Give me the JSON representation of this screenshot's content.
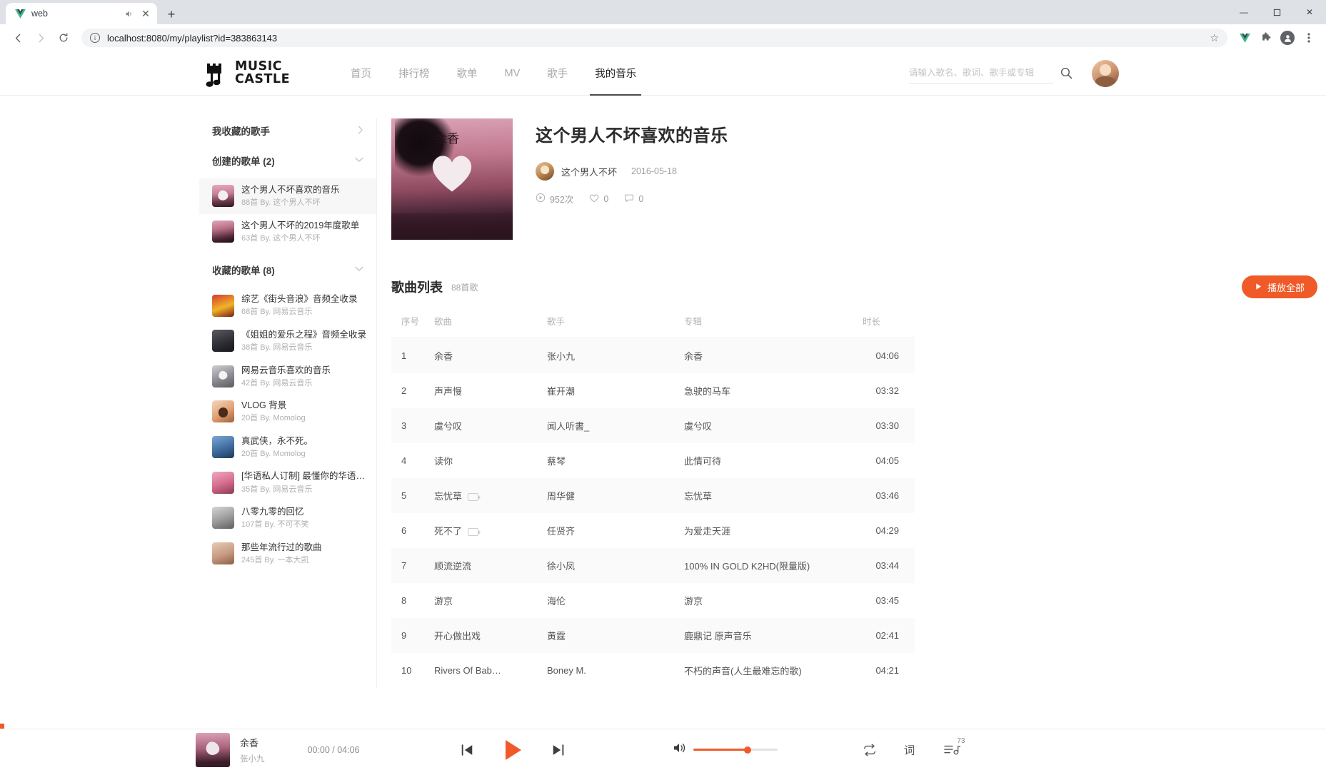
{
  "browser": {
    "tab_title": "web",
    "favicon": "vue-logo-icon",
    "audio_icon": "speaker-icon",
    "close_icon": "close-icon",
    "new_tab_icon": "plus-icon",
    "back_icon": "arrow-left-icon",
    "forward_icon": "arrow-right-icon",
    "reload_icon": "reload-icon",
    "info_icon": "info-icon",
    "url": "localhost:8080/my/playlist?id=383863143",
    "star_icon": "star-icon",
    "extensions_icon": "puzzle-icon",
    "profile_icon": "profile-avatar-icon",
    "menu_icon": "kebab-menu-icon",
    "minimize": "—",
    "maximize": "☐",
    "close": "✕"
  },
  "header": {
    "logo_line1": "MUSIC",
    "logo_line2": "CASTLE",
    "nav": [
      {
        "label": "首页",
        "active": false
      },
      {
        "label": "排行榜",
        "active": false
      },
      {
        "label": "歌单",
        "active": false
      },
      {
        "label": "MV",
        "active": false
      },
      {
        "label": "歌手",
        "active": false
      },
      {
        "label": "我的音乐",
        "active": true
      }
    ],
    "search_placeholder": "请输入歌名、歌词、歌手或专辑",
    "search_value": "",
    "search_icon": "search-icon",
    "avatar": "user-avatar"
  },
  "sidebar": {
    "favorite_artists": {
      "label": "我收藏的歌手",
      "chevron": "›"
    },
    "created_header": {
      "label": "创建的歌单 (2)",
      "chevron": "⌄"
    },
    "created": [
      {
        "title": "这个男人不坏喜欢的音乐",
        "sub": "88首 By. 这个男人不坏",
        "cover": "cov-sunset",
        "selected": true
      },
      {
        "title": "这个男人不坏的2019年度歌单",
        "sub": "63首 By. 这个男人不坏",
        "cover": "cov-sunset2",
        "selected": false
      }
    ],
    "collected_header": {
      "label": "收藏的歌单 (8)",
      "chevron": "⌄"
    },
    "collected": [
      {
        "title": "综艺《街头音浪》音频全收录",
        "sub": "68首 By. 网易云音乐",
        "cover": "cov-var"
      },
      {
        "title": "《姐姐的爱乐之程》音频全收录",
        "sub": "38首 By. 网易云音乐",
        "cover": "cov-grp"
      },
      {
        "title": "网易云音乐喜欢的音乐",
        "sub": "42首 By. 网易云音乐",
        "cover": "cov-bw"
      },
      {
        "title": "VLOG 背景",
        "sub": "20首 By. Momolog",
        "cover": "cov-vlog"
      },
      {
        "title": "真武侠，永不死。",
        "sub": "20首 By. Momolog",
        "cover": "cov-blue"
      },
      {
        "title": "[华语私人订制] 最懂你的华语推…",
        "sub": "35首 By. 网易云音乐",
        "cover": "cov-pink"
      },
      {
        "title": "八零九零的回忆",
        "sub": "107首 By. 不可不笑",
        "cover": "cov-gray"
      },
      {
        "title": "那些年流行过的歌曲",
        "sub": "245首 By. 一本大凯",
        "cover": "cov-warm"
      }
    ]
  },
  "playlist": {
    "name": "这个男人不坏喜欢的音乐",
    "creator": "这个男人不坏",
    "date": "2016-05-18",
    "cover_text": "余香",
    "stats": {
      "plays_icon": "play-count-icon",
      "plays": "952次",
      "likes_icon": "heart-icon",
      "likes": "0",
      "comments_icon": "comment-icon",
      "comments": "0"
    }
  },
  "song_list": {
    "title": "歌曲列表",
    "count": "88首歌",
    "play_all_label": "播放全部",
    "play_all_icon": "play-icon",
    "columns": [
      "序号",
      "歌曲",
      "歌手",
      "专辑",
      "时长"
    ],
    "rows": [
      {
        "no": "1",
        "song": "余香",
        "mv": false,
        "artist": "张小九",
        "album": "余香",
        "dur": "04:06"
      },
      {
        "no": "2",
        "song": "声声慢",
        "mv": false,
        "artist": "崔开潮",
        "album": "急驶的马车",
        "dur": "03:32"
      },
      {
        "no": "3",
        "song": "虞兮叹",
        "mv": false,
        "artist": "闻人听書_",
        "album": "虞兮叹",
        "dur": "03:30"
      },
      {
        "no": "4",
        "song": "读你",
        "mv": false,
        "artist": "蔡琴",
        "album": "此情可待",
        "dur": "04:05"
      },
      {
        "no": "5",
        "song": "忘忧草",
        "mv": true,
        "artist": "周华健",
        "album": "忘忧草",
        "dur": "03:46"
      },
      {
        "no": "6",
        "song": "死不了",
        "mv": true,
        "artist": "任贤齐",
        "album": "为爱走天涯",
        "dur": "04:29"
      },
      {
        "no": "7",
        "song": "顺流逆流",
        "mv": false,
        "artist": "徐小凤",
        "album": "100% IN GOLD K2HD(限量版)",
        "dur": "03:44"
      },
      {
        "no": "8",
        "song": "游京",
        "mv": false,
        "artist": "海伦",
        "album": "游京",
        "dur": "03:45"
      },
      {
        "no": "9",
        "song": "开心做出戏",
        "mv": false,
        "artist": "黄霆",
        "album": "鹿鼎记 原声音乐",
        "dur": "02:41"
      },
      {
        "no": "10",
        "song": "Rivers Of Bab…",
        "mv": false,
        "artist": "Boney M.",
        "album": "不朽的声音(人生最难忘的歌)",
        "dur": "04:21"
      }
    ]
  },
  "player": {
    "song": "余香",
    "artist": "张小九",
    "time": "00:00 / 04:06",
    "prev_icon": "previous-icon",
    "play_icon": "play-icon",
    "next_icon": "next-icon",
    "volume_icon": "volume-icon",
    "volume_percent": 64,
    "repeat_icon": "repeat-icon",
    "lyrics_icon": "lyrics-icon",
    "queue_icon": "queue-icon",
    "queue_count": "73",
    "lock_icon": "lock-icon"
  },
  "colors": {
    "accent": "#f05a28",
    "nav_active": "#222222",
    "muted": "#a8a8a8"
  }
}
